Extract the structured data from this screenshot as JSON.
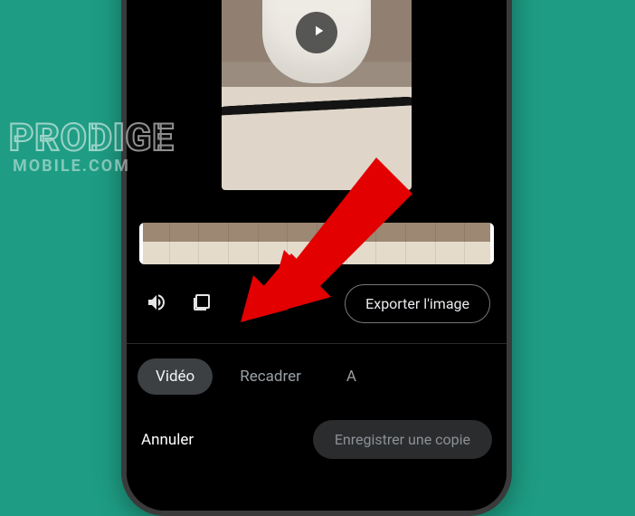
{
  "watermark": {
    "line1": "PRODIGE",
    "line2": "MOBILE.COM"
  },
  "toolbar": {
    "export_label": "Exporter l'image"
  },
  "tabs": {
    "items": [
      {
        "label": "Vidéo",
        "active": true
      },
      {
        "label": "Recadrer",
        "active": false
      },
      {
        "label": "A",
        "active": false
      }
    ]
  },
  "bottom": {
    "cancel_label": "Annuler",
    "save_label": "Enregistrer une copie"
  },
  "icons": {
    "play": "play-icon",
    "volume": "volume-icon",
    "frame_export": "frame-export-icon"
  }
}
